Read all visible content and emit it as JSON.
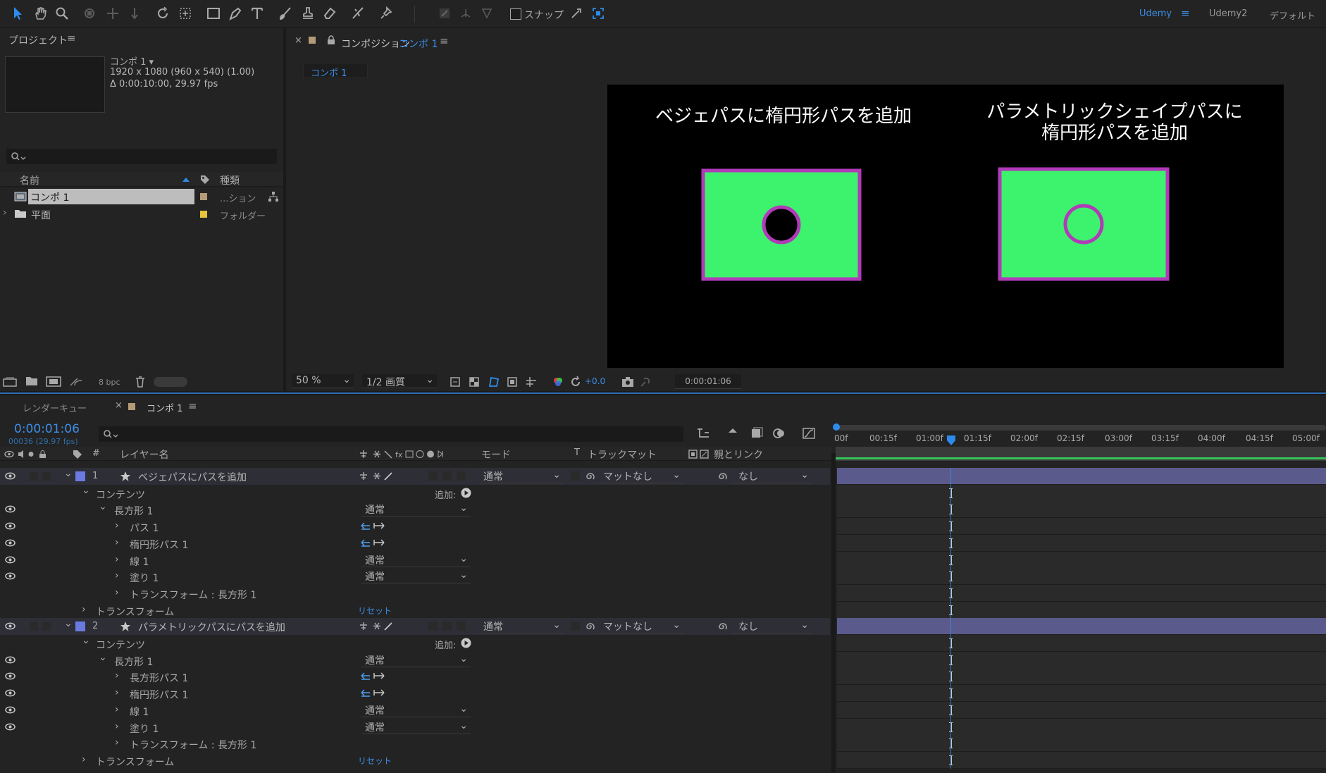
{
  "toolbar": {
    "snap_label": "スナップ",
    "workspaces": [
      "Udemy",
      "Udemy2",
      "デフォルト"
    ],
    "icons": [
      "selection-tool-icon",
      "hand-tool-icon",
      "zoom-tool-icon",
      "orbit-camera-icon",
      "pan-camera-icon",
      "dolly-camera-icon",
      "rotate-tool-icon",
      "pan-behind-icon",
      "rectangle-tool-icon",
      "pen-tool-icon",
      "type-tool-icon",
      "brush-tool-icon",
      "clone-stamp-icon",
      "eraser-icon",
      "roto-brush-icon",
      "puppet-pin-icon"
    ]
  },
  "project": {
    "title": "プロジェクト",
    "item_name": "コンポ 1",
    "item_dims": "1920 x 1080  (960 x 540) (1.00)",
    "item_duration": "Δ 0:00:10:00, 29.97 fps",
    "col_name": "名前",
    "col_type": "種類",
    "items": [
      {
        "name": "コンポ 1",
        "type": "...ション",
        "color": "#b59a77"
      },
      {
        "name": "平面",
        "type": "フォルダー",
        "color": "#e3c43b"
      }
    ],
    "bpc": "8 bpc"
  },
  "composition": {
    "tab_prefix": "コンポジション",
    "tab_name": "コンポ 1",
    "sub_tab": "コンポ 1",
    "left_title": "ベジェパスに楕円形パスを追加",
    "right_title_line1": "パラメトリックシェイプパスに",
    "right_title_line2": "楕円形パスを追加",
    "zoom": "50 %",
    "quality": "1/2 画質",
    "exposure": "+0.0",
    "timecode": "0:00:01:06",
    "colors": {
      "fill": "#3df26d",
      "stroke": "#b03ab8",
      "bg": "#000000"
    }
  },
  "timeline": {
    "render_queue_tab": "レンダーキュー",
    "comp_tab": "コンポ 1",
    "timecode": "0:00:01:06",
    "frames": "00036 (29.97 fps)",
    "ruler": [
      "00f",
      "00:15f",
      "01:00f",
      "01:15f",
      "02:00f",
      "02:15f",
      "03:00f",
      "03:15f",
      "04:00f",
      "04:15f",
      "05:00f"
    ],
    "col_num": "#",
    "col_layer_name": "レイヤー名",
    "col_mode": "モード",
    "col_t": "T",
    "col_trackmatte": "トラックマット",
    "col_parent": "親とリンク",
    "add_label": "追加:",
    "reset_label": "リセット",
    "layers": [
      {
        "num": "1",
        "name": "ベジェパスにパスを追加",
        "mode": "通常",
        "matte": "マットなし",
        "parent": "なし",
        "contents": "コンテンツ",
        "group": "長方形 1",
        "group_mode": "通常",
        "items": [
          {
            "name": "パス 1",
            "kind": "path"
          },
          {
            "name": "楕円形パス 1",
            "kind": "path"
          },
          {
            "name": "線 1",
            "kind": "mode",
            "mode": "通常"
          },
          {
            "name": "塗り 1",
            "kind": "mode",
            "mode": "通常"
          },
          {
            "name": "トランスフォーム : 長方形 1",
            "kind": "plain"
          }
        ],
        "transform": "トランスフォーム"
      },
      {
        "num": "2",
        "name": "パラメトリックパスにパスを追加",
        "mode": "通常",
        "matte": "マットなし",
        "parent": "なし",
        "contents": "コンテンツ",
        "group": "長方形 1",
        "group_mode": "通常",
        "items": [
          {
            "name": "長方形パス 1",
            "kind": "path"
          },
          {
            "name": "楕円形パス 1",
            "kind": "path"
          },
          {
            "name": "線 1",
            "kind": "mode",
            "mode": "通常"
          },
          {
            "name": "塗り 1",
            "kind": "mode",
            "mode": "通常"
          },
          {
            "name": "トランスフォーム : 長方形 1",
            "kind": "plain"
          }
        ],
        "transform": "トランスフォーム"
      }
    ]
  }
}
